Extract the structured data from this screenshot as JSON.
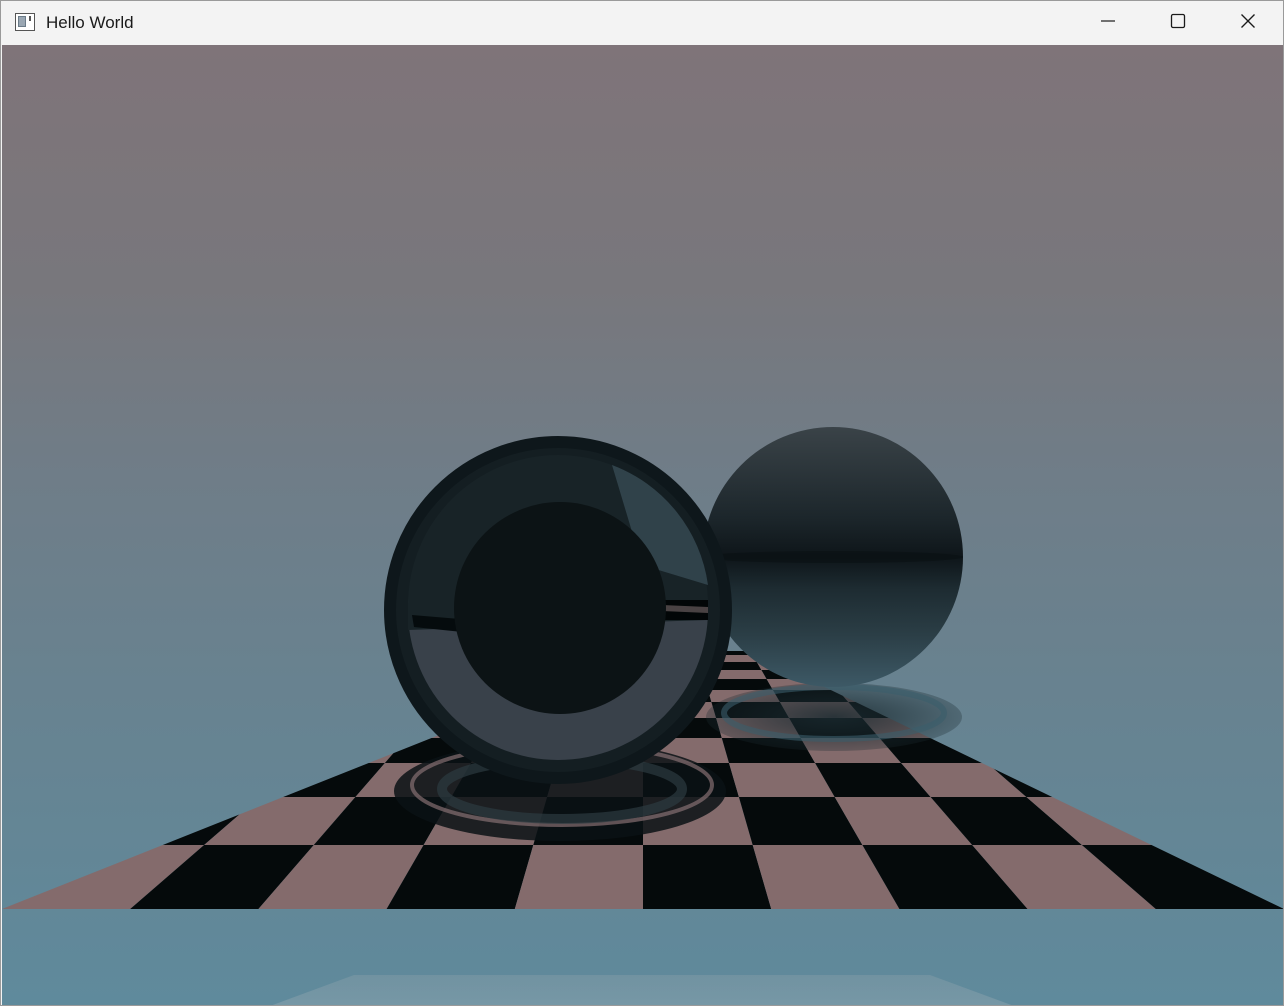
{
  "window": {
    "title": "Hello World",
    "controls": {
      "minimize_icon": "minimize-icon",
      "maximize_icon": "maximize-icon",
      "close_icon": "close-icon"
    }
  },
  "scene": {
    "description_icon": "rendered-3d-scene",
    "colors": {
      "sky_top": "#7f7479",
      "sky_bottom": "#5f8a9c",
      "checker_light": "#846b6c",
      "checker_dark": "#050a0b",
      "sphere_dark": "#0f1a1e",
      "sphere_metal": "#2a3b44"
    }
  }
}
